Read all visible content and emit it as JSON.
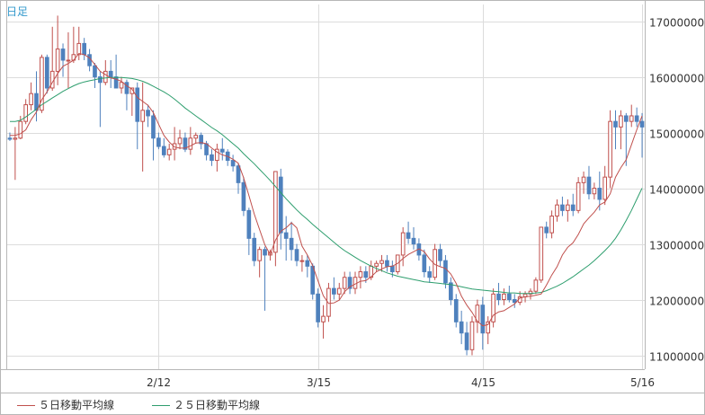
{
  "chart_data": {
    "type": "candlestick",
    "period_label": "日足",
    "ylim": [
      10750000,
      17300000
    ],
    "yticks": [
      11000000,
      12000000,
      13000000,
      14000000,
      15000000,
      16000000,
      17000000
    ],
    "ytick_labels": [
      "11000000",
      "12000000",
      "13000000",
      "14000000",
      "15000000",
      "16000000",
      "17000000"
    ],
    "x_ticks": [
      {
        "index": 28,
        "label": "2/12"
      },
      {
        "index": 58,
        "label": "3/15"
      },
      {
        "index": 89,
        "label": "4/15"
      },
      {
        "index": 119,
        "label": "5/16"
      }
    ],
    "series": [
      {
        "name": "５日移動平均線",
        "color": "#c0504d"
      },
      {
        "name": "２５日移動平均線",
        "color": "#2e9e6e"
      }
    ],
    "colors": {
      "up": "#c0504d",
      "down": "#4f81bd",
      "ma5": "#c0504d",
      "ma25": "#2e9e6e",
      "grid": "#dcdcdc"
    },
    "ohlc": [
      [
        14.9,
        15.0,
        14.85,
        14.88
      ],
      [
        14.88,
        15.1,
        14.15,
        14.9
      ],
      [
        14.9,
        15.3,
        14.88,
        15.2
      ],
      [
        15.2,
        15.6,
        15.15,
        15.5
      ],
      [
        15.5,
        15.9,
        15.4,
        15.7
      ],
      [
        15.7,
        16.1,
        15.2,
        15.4
      ],
      [
        15.4,
        16.4,
        15.35,
        16.35
      ],
      [
        16.35,
        16.4,
        15.7,
        15.8
      ],
      [
        15.8,
        16.9,
        15.75,
        16.1
      ],
      [
        16.1,
        17.1,
        15.85,
        16.5
      ],
      [
        16.5,
        16.6,
        16.0,
        16.3
      ],
      [
        16.3,
        16.8,
        15.8,
        16.3
      ],
      [
        16.3,
        16.9,
        16.25,
        16.4
      ],
      [
        16.4,
        16.9,
        16.3,
        16.6
      ],
      [
        16.6,
        16.7,
        16.3,
        16.4
      ],
      [
        16.4,
        16.5,
        16.1,
        16.2
      ],
      [
        16.2,
        16.25,
        15.8,
        16.0
      ],
      [
        16.0,
        16.1,
        15.1,
        15.9
      ],
      [
        15.9,
        16.3,
        15.85,
        16.1
      ],
      [
        16.1,
        16.3,
        15.8,
        16.0
      ],
      [
        16.0,
        16.4,
        15.8,
        15.8
      ],
      [
        15.8,
        16.0,
        15.7,
        15.9
      ],
      [
        15.9,
        15.95,
        15.4,
        15.7
      ],
      [
        15.7,
        15.8,
        15.3,
        15.8
      ],
      [
        15.8,
        15.9,
        14.7,
        15.2
      ],
      [
        15.2,
        15.9,
        14.3,
        15.4
      ],
      [
        15.4,
        15.5,
        15.1,
        15.3
      ],
      [
        15.3,
        15.4,
        14.5,
        14.9
      ],
      [
        14.9,
        15.0,
        14.7,
        14.75
      ],
      [
        14.75,
        14.9,
        14.55,
        14.6
      ],
      [
        14.6,
        14.8,
        14.5,
        14.7
      ],
      [
        14.7,
        15.1,
        14.5,
        14.8
      ],
      [
        14.8,
        15.05,
        14.7,
        14.9
      ],
      [
        14.9,
        15.0,
        14.65,
        14.7
      ],
      [
        14.7,
        15.1,
        14.6,
        14.9
      ],
      [
        14.9,
        15.0,
        14.8,
        14.95
      ],
      [
        14.95,
        15.0,
        14.7,
        14.8
      ],
      [
        14.8,
        14.85,
        14.5,
        14.6
      ],
      [
        14.6,
        14.7,
        14.4,
        14.5
      ],
      [
        14.5,
        14.8,
        14.3,
        14.7
      ],
      [
        14.7,
        14.9,
        14.5,
        14.65
      ],
      [
        14.65,
        14.7,
        14.4,
        14.5
      ],
      [
        14.5,
        14.6,
        14.3,
        14.4
      ],
      [
        14.4,
        14.45,
        13.9,
        14.1
      ],
      [
        14.1,
        14.2,
        13.5,
        13.6
      ],
      [
        13.6,
        13.65,
        12.8,
        13.1
      ],
      [
        13.1,
        13.2,
        12.6,
        12.7
      ],
      [
        12.7,
        12.95,
        12.4,
        12.9
      ],
      [
        12.9,
        12.95,
        11.8,
        12.8
      ],
      [
        12.8,
        12.9,
        12.7,
        12.85
      ],
      [
        12.85,
        14.3,
        12.6,
        14.3
      ],
      [
        14.2,
        14.35,
        12.9,
        13.2
      ],
      [
        13.2,
        13.5,
        12.7,
        13.1
      ],
      [
        13.1,
        13.4,
        12.7,
        12.9
      ],
      [
        12.9,
        13.0,
        12.6,
        12.7
      ],
      [
        12.7,
        12.8,
        12.5,
        12.7
      ],
      [
        12.7,
        12.8,
        12.4,
        12.6
      ],
      [
        12.6,
        12.65,
        12.0,
        12.1
      ],
      [
        12.1,
        12.2,
        11.5,
        11.6
      ],
      [
        11.6,
        11.9,
        11.3,
        11.7
      ],
      [
        11.7,
        12.3,
        11.6,
        12.2
      ],
      [
        12.2,
        12.4,
        12.0,
        12.1
      ],
      [
        12.1,
        12.3,
        12.0,
        12.2
      ],
      [
        12.2,
        12.5,
        12.1,
        12.4
      ],
      [
        12.4,
        12.5,
        12.1,
        12.2
      ],
      [
        12.2,
        12.5,
        12.1,
        12.4
      ],
      [
        12.4,
        12.6,
        12.2,
        12.5
      ],
      [
        12.5,
        12.6,
        12.3,
        12.4
      ],
      [
        12.4,
        12.7,
        12.35,
        12.6
      ],
      [
        12.6,
        12.7,
        12.5,
        12.65
      ],
      [
        12.65,
        12.8,
        12.5,
        12.7
      ],
      [
        12.7,
        12.8,
        12.5,
        12.6
      ],
      [
        12.6,
        12.7,
        12.4,
        12.5
      ],
      [
        12.5,
        12.8,
        12.45,
        12.8
      ],
      [
        12.8,
        13.3,
        12.6,
        13.2
      ],
      [
        13.2,
        13.4,
        13.0,
        13.1
      ],
      [
        13.1,
        13.3,
        12.9,
        13.0
      ],
      [
        13.0,
        13.1,
        12.7,
        12.8
      ],
      [
        12.8,
        12.9,
        12.4,
        12.5
      ],
      [
        12.5,
        12.6,
        12.3,
        12.4
      ],
      [
        12.4,
        13.0,
        12.35,
        12.9
      ],
      [
        12.9,
        13.0,
        12.6,
        12.7
      ],
      [
        12.7,
        12.8,
        12.2,
        12.3
      ],
      [
        12.3,
        12.4,
        11.9,
        12.0
      ],
      [
        12.0,
        12.1,
        11.5,
        11.6
      ],
      [
        11.6,
        11.8,
        11.2,
        11.4
      ],
      [
        11.4,
        11.6,
        11.0,
        11.1
      ],
      [
        11.1,
        11.7,
        11.0,
        11.6
      ],
      [
        11.6,
        12.0,
        11.4,
        11.9
      ],
      [
        11.9,
        12.05,
        11.1,
        11.4
      ],
      [
        11.4,
        11.7,
        11.2,
        11.6
      ],
      [
        11.6,
        12.2,
        11.5,
        12.1
      ],
      [
        12.1,
        12.3,
        11.9,
        12.0
      ],
      [
        12.0,
        12.2,
        11.9,
        12.1
      ],
      [
        12.1,
        12.25,
        11.95,
        12.0
      ],
      [
        12.0,
        12.1,
        11.85,
        11.95
      ],
      [
        11.95,
        12.15,
        11.9,
        12.05
      ],
      [
        12.05,
        12.15,
        11.95,
        12.1
      ],
      [
        12.1,
        12.2,
        12.0,
        12.15
      ],
      [
        12.15,
        12.4,
        12.1,
        12.35
      ],
      [
        12.35,
        13.3,
        12.3,
        13.3
      ],
      [
        13.3,
        13.4,
        13.1,
        13.2
      ],
      [
        13.2,
        13.6,
        13.1,
        13.5
      ],
      [
        13.5,
        13.8,
        13.4,
        13.7
      ],
      [
        13.7,
        13.85,
        13.5,
        13.6
      ],
      [
        13.6,
        13.8,
        13.4,
        13.7
      ],
      [
        13.7,
        13.9,
        13.5,
        13.6
      ],
      [
        13.6,
        14.2,
        13.55,
        14.1
      ],
      [
        14.1,
        14.3,
        13.9,
        14.2
      ],
      [
        14.2,
        14.4,
        13.8,
        13.9
      ],
      [
        13.9,
        14.1,
        13.8,
        14.0
      ],
      [
        14.0,
        14.3,
        13.6,
        13.8
      ],
      [
        13.8,
        14.4,
        13.7,
        14.2
      ],
      [
        14.2,
        15.4,
        14.0,
        15.2
      ],
      [
        15.2,
        15.4,
        14.7,
        15.1
      ],
      [
        15.1,
        15.4,
        14.7,
        15.3
      ],
      [
        15.3,
        15.35,
        14.4,
        15.2
      ],
      [
        15.2,
        15.5,
        15.1,
        15.3
      ],
      [
        15.3,
        15.45,
        15.1,
        15.2
      ],
      [
        15.2,
        15.35,
        14.55,
        15.1
      ]
    ],
    "ma5": [
      14.95,
      14.95,
      14.98,
      15.05,
      15.23,
      15.37,
      15.59,
      15.73,
      15.9,
      16.06,
      16.19,
      16.24,
      16.3,
      16.42,
      16.4,
      16.34,
      16.22,
      16.1,
      16.04,
      15.98,
      15.96,
      15.92,
      15.84,
      15.78,
      15.63,
      15.56,
      15.49,
      15.36,
      15.15,
      14.95,
      14.83,
      14.74,
      14.72,
      14.72,
      14.76,
      14.81,
      14.82,
      14.8,
      14.72,
      14.65,
      14.6,
      14.57,
      14.52,
      14.45,
      14.19,
      13.87,
      13.54,
      13.26,
      12.98,
      12.81,
      13.07,
      13.23,
      13.29,
      13.38,
      13.29,
      12.96,
      12.8,
      12.61,
      12.34,
      12.07,
      11.93,
      11.94,
      11.99,
      12.14,
      12.23,
      12.28,
      12.33,
      12.34,
      12.41,
      12.5,
      12.55,
      12.59,
      12.6,
      12.65,
      12.74,
      12.81,
      12.86,
      12.91,
      12.86,
      12.73,
      12.63,
      12.59,
      12.56,
      12.46,
      12.29,
      12.06,
      11.9,
      11.77,
      11.61,
      11.53,
      11.55,
      11.72,
      11.78,
      11.8,
      11.86,
      11.92,
      12.03,
      12.05,
      12.06,
      12.08,
      12.1,
      12.26,
      12.44,
      12.59,
      12.8,
      12.94,
      13.02,
      13.17,
      13.36,
      13.47,
      13.57,
      13.7,
      13.75,
      13.9,
      14.2,
      14.37,
      14.51,
      14.78,
      15.05,
      15.3
    ],
    "ma25": [
      15.2,
      15.2,
      15.22,
      15.28,
      15.35,
      15.42,
      15.5,
      15.56,
      15.62,
      15.68,
      15.74,
      15.79,
      15.84,
      15.88,
      15.91,
      15.93,
      15.95,
      15.97,
      15.98,
      15.99,
      15.99,
      15.99,
      15.98,
      15.97,
      15.95,
      15.92,
      15.88,
      15.83,
      15.78,
      15.73,
      15.67,
      15.6,
      15.52,
      15.44,
      15.37,
      15.3,
      15.23,
      15.16,
      15.09,
      15.03,
      14.96,
      14.88,
      14.8,
      14.72,
      14.62,
      14.53,
      14.44,
      14.34,
      14.24,
      14.14,
      14.03,
      13.92,
      13.81,
      13.71,
      13.61,
      13.52,
      13.44,
      13.35,
      13.27,
      13.19,
      13.11,
      13.03,
      12.95,
      12.88,
      12.82,
      12.76,
      12.7,
      12.65,
      12.6,
      12.56,
      12.52,
      12.48,
      12.45,
      12.42,
      12.4,
      12.38,
      12.36,
      12.34,
      12.32,
      12.31,
      12.3,
      12.29,
      12.28,
      12.27,
      12.25,
      12.23,
      12.21,
      12.19,
      12.18,
      12.17,
      12.16,
      12.15,
      12.14,
      12.13,
      12.12,
      12.12,
      12.11,
      12.11,
      12.11,
      12.12,
      12.13,
      12.16,
      12.2,
      12.24,
      12.29,
      12.35,
      12.41,
      12.48,
      12.55,
      12.62,
      12.7,
      12.79,
      12.88,
      12.98,
      13.1,
      13.25,
      13.42,
      13.6,
      13.8,
      14.0
    ]
  }
}
